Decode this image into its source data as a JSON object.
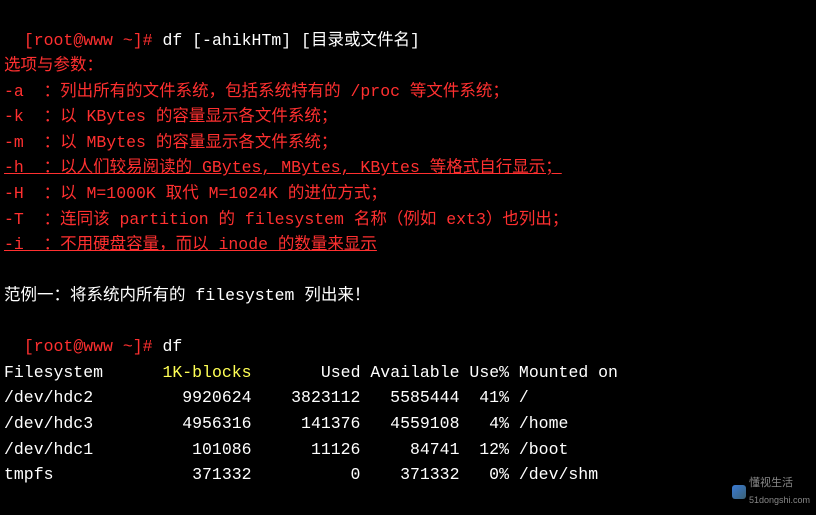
{
  "prompt1": {
    "user_host": "[root@www ~]# ",
    "command": "df [-ahikHTm] [目录或文件名]"
  },
  "options_header": "选项与参数：",
  "options": [
    {
      "text": "-a  ：列出所有的文件系统，包括系统特有的 /proc 等文件系统；",
      "underline": false
    },
    {
      "text": "-k  ：以 KBytes 的容量显示各文件系统；",
      "underline": false
    },
    {
      "text": "-m  ：以 MBytes 的容量显示各文件系统；",
      "underline": false
    },
    {
      "text": "-h  ：以人们较易阅读的 GBytes, MBytes, KBytes 等格式自行显示；",
      "underline": true
    },
    {
      "text": "-H  ：以 M=1000K 取代 M=1024K 的进位方式；",
      "underline": false
    },
    {
      "text": "-T  ：连同该 partition 的 filesystem 名称（例如 ext3）也列出；",
      "underline": false
    },
    {
      "text": "-i  ：不用硬盘容量，而以 inode 的数量来显示",
      "underline": true
    }
  ],
  "blank": " ",
  "example_label": "范例一：将系统内所有的 filesystem 列出来！",
  "prompt2": {
    "user_host": "[root@www ~]# ",
    "command": "df"
  },
  "table": {
    "header": {
      "c1": "Filesystem",
      "c2": "1K-blocks",
      "c3": "Used",
      "c4": "Available",
      "c5": "Use%",
      "c6": "Mounted on"
    },
    "rows": [
      {
        "fs": "/dev/hdc2",
        "blocks": "9920624",
        "used": "3823112",
        "avail": "5585444",
        "usep": "41%",
        "mount": "/"
      },
      {
        "fs": "/dev/hdc3",
        "blocks": "4956316",
        "used": "141376",
        "avail": "4559108",
        "usep": "4%",
        "mount": "/home"
      },
      {
        "fs": "/dev/hdc1",
        "blocks": "101086",
        "used": "11126",
        "avail": "84741",
        "usep": "12%",
        "mount": "/boot"
      },
      {
        "fs": "tmpfs",
        "blocks": "371332",
        "used": "0",
        "avail": "371332",
        "usep": "0%",
        "mount": "/dev/shm"
      }
    ]
  },
  "watermark": {
    "brand": "懂视生活",
    "url": "51dongshi.com"
  },
  "chart_data": {
    "type": "table",
    "title": "df output — filesystem disk usage",
    "columns": [
      "Filesystem",
      "1K-blocks",
      "Used",
      "Available",
      "Use%",
      "Mounted on"
    ],
    "rows": [
      [
        "/dev/hdc2",
        9920624,
        3823112,
        5585444,
        "41%",
        "/"
      ],
      [
        "/dev/hdc3",
        4956316,
        141376,
        4559108,
        "4%",
        "/home"
      ],
      [
        "/dev/hdc1",
        101086,
        11126,
        84741,
        "12%",
        "/boot"
      ],
      [
        "tmpfs",
        371332,
        0,
        371332,
        "0%",
        "/dev/shm"
      ]
    ]
  }
}
